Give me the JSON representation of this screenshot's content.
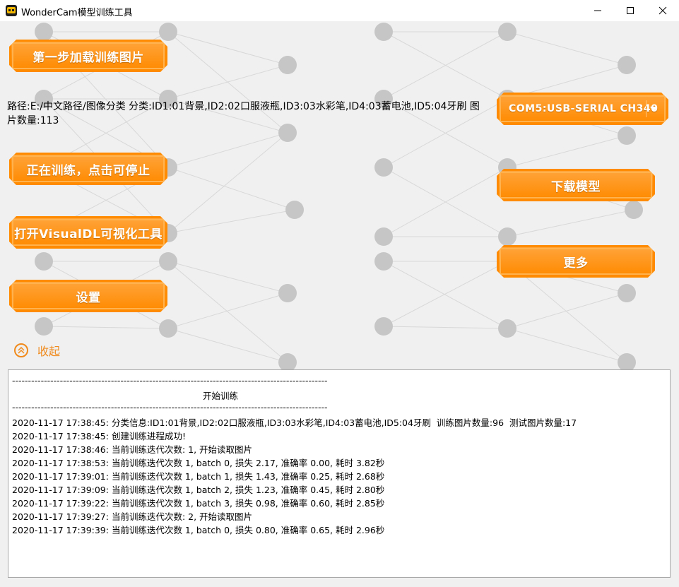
{
  "window": {
    "title": "WonderCam模型训练工具",
    "minimize_icon": "minimize-icon",
    "maximize_icon": "maximize-icon",
    "close_icon": "close-icon"
  },
  "buttons": {
    "load_images": "第一步加载训练图片",
    "training": "正在训练，点击可停止",
    "visualdl": "打开VisualDL可视化工具",
    "settings": "设置",
    "download_model": "下载模型",
    "more": "更多"
  },
  "serial_port": {
    "selected": "COM5:USB-SERIAL CH340",
    "arrow_icon": "dropdown-arrow-icon"
  },
  "dataset_info": {
    "text": "路径:E:/中文路径/图像分类   分类:ID1:01背景,ID2:02口服液瓶,ID3:03水彩笔,ID4:03蓄电池,ID5:04牙刷   图片数量:113"
  },
  "collapse": {
    "label": "收起",
    "icon": "double-chevron-up-icon"
  },
  "log": {
    "separator": "---------------------------------------------------------------------------------------------------",
    "header": "开始训练",
    "lines": [
      "2020-11-17 17:38:45: 分类信息:ID1:01背景,ID2:02口服液瓶,ID3:03水彩笔,ID4:03蓄电池,ID5:04牙刷  训练图片数量:96  测试图片数量:17",
      "2020-11-17 17:38:45: 创建训练进程成功!",
      "2020-11-17 17:38:46: 当前训练迭代次数: 1, 开始读取图片",
      "2020-11-17 17:38:53: 当前训练迭代次数 1, batch 0, 损失 2.17, 准确率 0.00, 耗时 3.82秒",
      "2020-11-17 17:39:01: 当前训练迭代次数 1, batch 1, 损失 1.43, 准确率 0.25, 耗时 2.68秒",
      "2020-11-17 17:39:09: 当前训练迭代次数 1, batch 2, 损失 1.23, 准确率 0.45, 耗时 2.80秒",
      "2020-11-17 17:39:22: 当前训练迭代次数 1, batch 3, 损失 0.98, 准确率 0.60, 耗时 2.85秒",
      "2020-11-17 17:39:27: 当前训练迭代次数: 2, 开始读取图片",
      "2020-11-17 17:39:39: 当前训练迭代次数 1, batch 0, 损失 0.80, 准确率 0.65, 耗时 2.96秒"
    ]
  },
  "colors": {
    "accent": "#ff8c00",
    "collapse": "#f08a1c",
    "node": "#c6c6c6"
  }
}
